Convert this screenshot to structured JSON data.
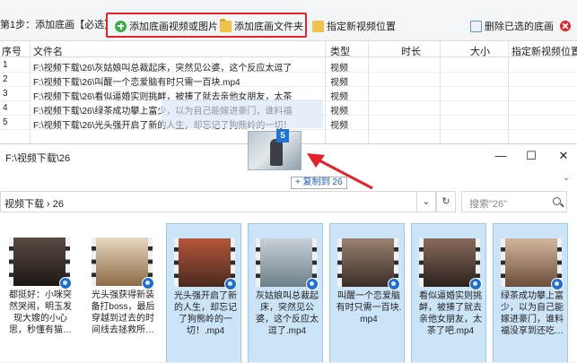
{
  "toolbar": {
    "step_label": "第1步：添加底画【必选】",
    "buttons": {
      "add_media": "添加底画视频或图片",
      "add_folder": "添加底画文件夹",
      "set_position": "指定新视频位置",
      "delete_selected": "删除已选的底画"
    },
    "icons": {
      "add": "plus-circle-icon",
      "folder": "folder-icon",
      "position": "folder-pin-icon",
      "delete": "delete-icon",
      "close": "close-icon"
    },
    "highlight_color": "#e8202a"
  },
  "grid": {
    "columns": [
      "序号",
      "文件名",
      "类型",
      "时长",
      "大小",
      "指定新视频位置"
    ],
    "rows": [
      {
        "no": "1",
        "name": "F:\\视频下载\\26\\灰姑娘叫总裁起床，突然见公婆，这个反应太逗了",
        "type": "视频"
      },
      {
        "no": "2",
        "name": "F:\\视频下载\\26\\叫醒一个恋爱脑有时只需一百块.mp4",
        "type": "视频"
      },
      {
        "no": "3",
        "name": "F:\\视频下载\\26\\看似逼婚实则挑衅，被揍了就去亲他女朋友，太茶",
        "type": "视频"
      },
      {
        "no": "4",
        "name": "F:\\视频下载\\26\\绿茶成功攀上富少，以为自己能嫁进豪门，谁料福",
        "type": "视频"
      },
      {
        "no": "5",
        "name": "F:\\视频下载\\26\\光头强开启了新的人生，却忘记了狗熊岭的一切！",
        "type": "视频"
      }
    ]
  },
  "drag": {
    "count_badge": "5",
    "tooltip": "+ 复制到 26",
    "arrow_color": "#e8202a"
  },
  "explorer": {
    "title": "F:\\视频下载\\26",
    "controls": {
      "minimize": "—",
      "maximize": "☐",
      "close": "✕"
    },
    "breadcrumb": "视频下载 › 26",
    "dropdown_glyph": "⌄",
    "refresh_glyph": "↻",
    "search_placeholder": "搜索\"26\"",
    "files": [
      {
        "label": "都挺好：小咪突然哭闹，明玉发现大嫂的小心思，秒懂有猫…",
        "selected": false
      },
      {
        "label": "光头强获得新装备打boss，最后穿越到过去的时间线去拯救所…",
        "selected": false
      },
      {
        "label": "光头强开启了新的人生，却忘记了狗熊岭的一切！.mp4",
        "selected": true
      },
      {
        "label": "灰姑娘叫总裁起床，突然见公婆，这个反应太逗了.mp4",
        "selected": true
      },
      {
        "label": "叫醒一个恋爱脑有时只需一百块.mp4",
        "selected": true
      },
      {
        "label": "看似逼婚实则挑衅，被揍了就去亲他女朋友，太茶了吧.mp4",
        "selected": true
      },
      {
        "label": "绿茶成功攀上富少，以为自己能嫁进豪门，谁料福没享到还吃…",
        "selected": true
      }
    ]
  }
}
